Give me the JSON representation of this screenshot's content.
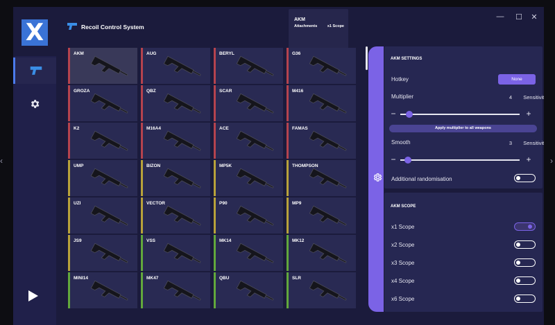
{
  "window": {
    "title": "Recoil Control System",
    "logo_letter": "X",
    "controls": {
      "minimize": "—",
      "maximize": "☐",
      "close": "✕"
    }
  },
  "info": {
    "weapon": "AKM",
    "attachments_label": "Attachments",
    "scope": "x1 Scope"
  },
  "sidebar": {
    "items": [
      {
        "name": "weapons",
        "icon": "gun-icon",
        "active": true
      },
      {
        "name": "settings",
        "icon": "gear-icon",
        "active": false
      }
    ],
    "play_icon": "play-icon"
  },
  "colors": {
    "accent": "#7b63e6",
    "red": "#b5434e",
    "yellow": "#b8a23a",
    "green": "#62a83c",
    "blue": "#3a73d6"
  },
  "weapons": [
    {
      "name": "AKM",
      "tier": "red",
      "selected": true
    },
    {
      "name": "AUG",
      "tier": "red"
    },
    {
      "name": "BERYL",
      "tier": "red"
    },
    {
      "name": "G36",
      "tier": "red"
    },
    {
      "name": "GROZA",
      "tier": "red"
    },
    {
      "name": "QBZ",
      "tier": "red"
    },
    {
      "name": "SCAR",
      "tier": "red"
    },
    {
      "name": "M416",
      "tier": "red"
    },
    {
      "name": "K2",
      "tier": "red"
    },
    {
      "name": "M16A4",
      "tier": "red"
    },
    {
      "name": "ACE",
      "tier": "red"
    },
    {
      "name": "FAMAS",
      "tier": "red"
    },
    {
      "name": "UMP",
      "tier": "yellow"
    },
    {
      "name": "BIZON",
      "tier": "yellow"
    },
    {
      "name": "MP5K",
      "tier": "yellow"
    },
    {
      "name": "THOMPSON",
      "tier": "yellow"
    },
    {
      "name": "UZI",
      "tier": "yellow"
    },
    {
      "name": "VECTOR",
      "tier": "yellow"
    },
    {
      "name": "P90",
      "tier": "yellow"
    },
    {
      "name": "MP9",
      "tier": "yellow"
    },
    {
      "name": "JS9",
      "tier": "yellow"
    },
    {
      "name": "VSS",
      "tier": "green"
    },
    {
      "name": "MK14",
      "tier": "green"
    },
    {
      "name": "MK12",
      "tier": "green"
    },
    {
      "name": "MINI14",
      "tier": "green"
    },
    {
      "name": "MK47",
      "tier": "green"
    },
    {
      "name": "QBU",
      "tier": "green"
    },
    {
      "name": "SLR",
      "tier": "green"
    }
  ],
  "settings": {
    "title": "AKM SETTINGS",
    "hotkey_label": "Hotkey",
    "hotkey_value": "None",
    "multiplier_label": "Multiplier",
    "multiplier_value": "4",
    "multiplier_unit": "Sensitivity",
    "multiplier_fraction": 0.05,
    "apply_label": "Apply multiplier to all weapons",
    "smooth_label": "Smooth",
    "smooth_value": "3",
    "smooth_unit": "Sensitivity",
    "smooth_fraction": 0.04,
    "minus": "−",
    "plus": "+",
    "randomisation_label": "Additional randomisation",
    "randomisation_on": false
  },
  "scope": {
    "title": "AKM SCOPE",
    "items": [
      {
        "label": "x1 Scope",
        "on": true
      },
      {
        "label": "x2 Scope",
        "on": false
      },
      {
        "label": "x3 Scope",
        "on": false
      },
      {
        "label": "x4 Scope",
        "on": false
      },
      {
        "label": "x6 Scope",
        "on": false
      }
    ]
  }
}
